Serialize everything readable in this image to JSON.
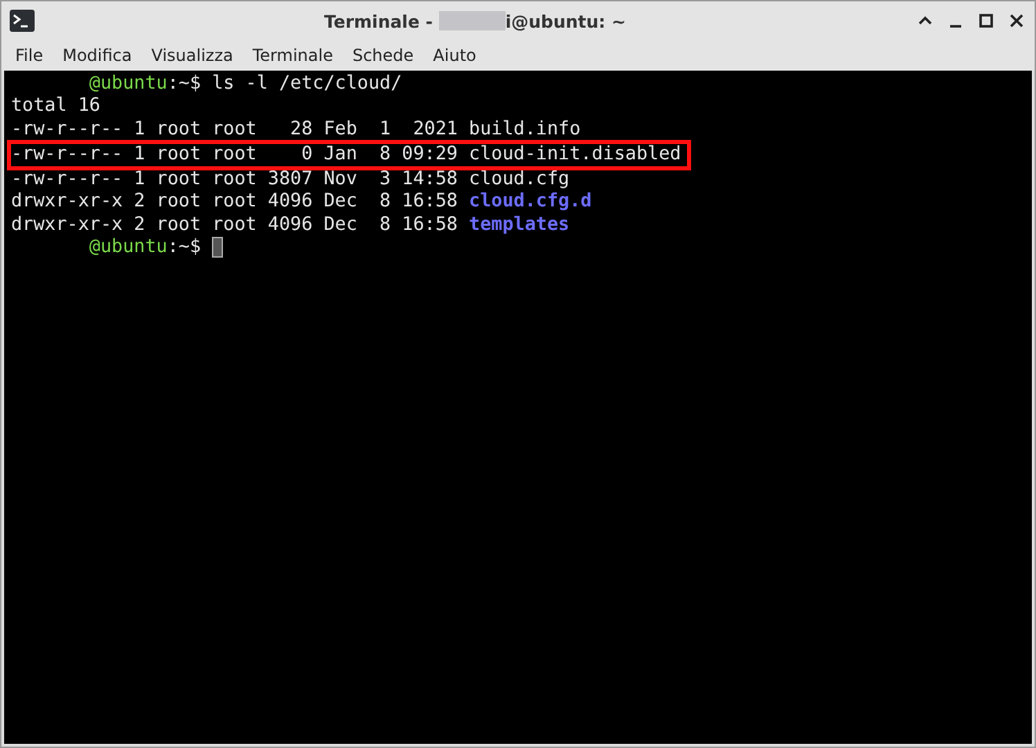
{
  "window": {
    "title_prefix": "Terminale - ",
    "title_suffix": "i@ubuntu: ~"
  },
  "menu": [
    "File",
    "Modifica",
    "Visualizza",
    "Terminale",
    "Schede",
    "Aiuto"
  ],
  "lines": [
    {
      "highlighted": false,
      "segments": [
        {
          "kind": "redacted"
        },
        {
          "kind": "host",
          "text": "@ubuntu"
        },
        {
          "kind": "plain",
          "text": ":~$ ls -l /etc/cloud/"
        }
      ]
    },
    {
      "highlighted": false,
      "segments": [
        {
          "kind": "plain",
          "text": "total 16"
        }
      ]
    },
    {
      "highlighted": false,
      "segments": [
        {
          "kind": "plain",
          "text": "-rw-r--r-- 1 root root   28 Feb  1  2021 build.info"
        }
      ]
    },
    {
      "highlighted": true,
      "segments": [
        {
          "kind": "plain",
          "text": "-rw-r--r-- 1 root root    0 Jan  8 09:29 cloud-init.disabled"
        }
      ]
    },
    {
      "highlighted": false,
      "segments": [
        {
          "kind": "plain",
          "text": "-rw-r--r-- 1 root root 3807 Nov  3 14:58 cloud.cfg"
        }
      ]
    },
    {
      "highlighted": false,
      "segments": [
        {
          "kind": "plain",
          "text": "drwxr-xr-x 2 root root 4096 Dec  8 16:58 "
        },
        {
          "kind": "dir",
          "text": "cloud.cfg.d"
        }
      ]
    },
    {
      "highlighted": false,
      "segments": [
        {
          "kind": "plain",
          "text": "drwxr-xr-x 2 root root 4096 Dec  8 16:58 "
        },
        {
          "kind": "dir",
          "text": "templates"
        }
      ]
    },
    {
      "highlighted": false,
      "segments": [
        {
          "kind": "redacted"
        },
        {
          "kind": "host",
          "text": "@ubuntu"
        },
        {
          "kind": "plain",
          "text": ":~$ "
        },
        {
          "kind": "cursor"
        }
      ]
    }
  ]
}
